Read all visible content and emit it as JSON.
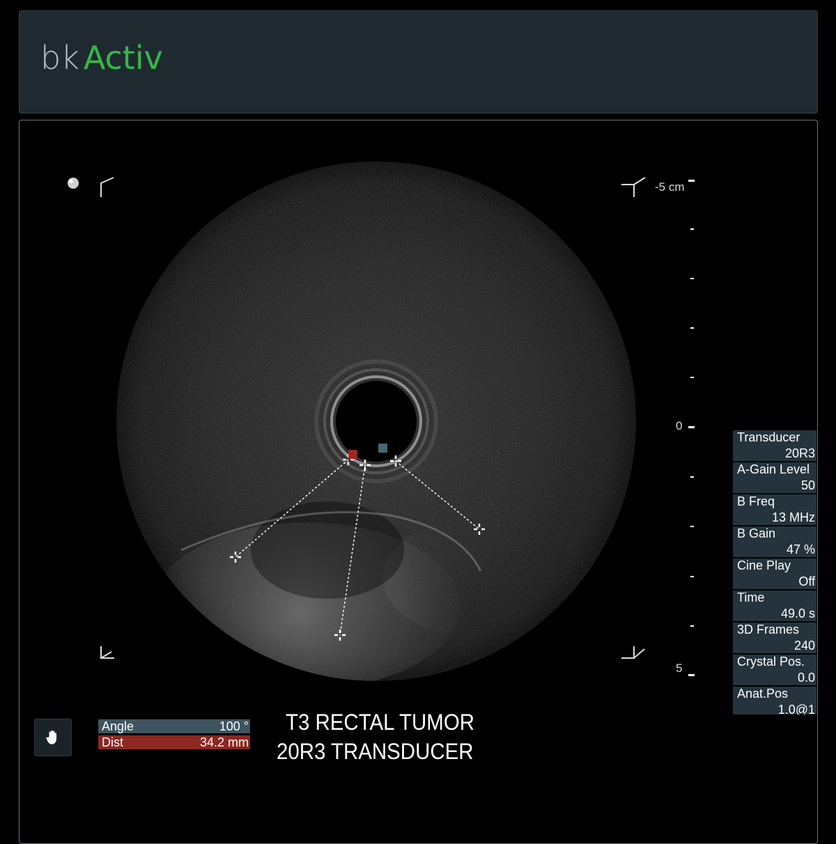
{
  "header": {
    "logo_bk": "bk",
    "logo_activ": "Activ",
    "brand_color": "#39b54a"
  },
  "scale": {
    "top_label": "-5 cm",
    "zero_label": "0",
    "bottom_label": "5"
  },
  "params": [
    {
      "label": "Transducer",
      "value": "20R3"
    },
    {
      "label": "A-Gain Level",
      "value": "50"
    },
    {
      "label": "B Freq",
      "value": "13 MHz"
    },
    {
      "label": "B Gain",
      "value": "47 %"
    },
    {
      "label": "Cine Play",
      "value": "Off"
    },
    {
      "label": "Time",
      "value": "49.0 s"
    },
    {
      "label": "3D Frames",
      "value": "240"
    },
    {
      "label": "Crystal Pos.",
      "value": "0.0"
    },
    {
      "label": "Anat.Pos",
      "value": "1.0@1"
    }
  ],
  "measurement": {
    "angle_label": "Angle",
    "angle_value": "100 °",
    "dist_label": "Dist",
    "dist_value": "34.2 mm"
  },
  "caption": {
    "line1": "T3 RECTAL TUMOR",
    "line2": "20R3 TRANSDUCER"
  },
  "icons": {
    "orientation": "orientation-marker-icon",
    "hand": "hand-icon"
  }
}
